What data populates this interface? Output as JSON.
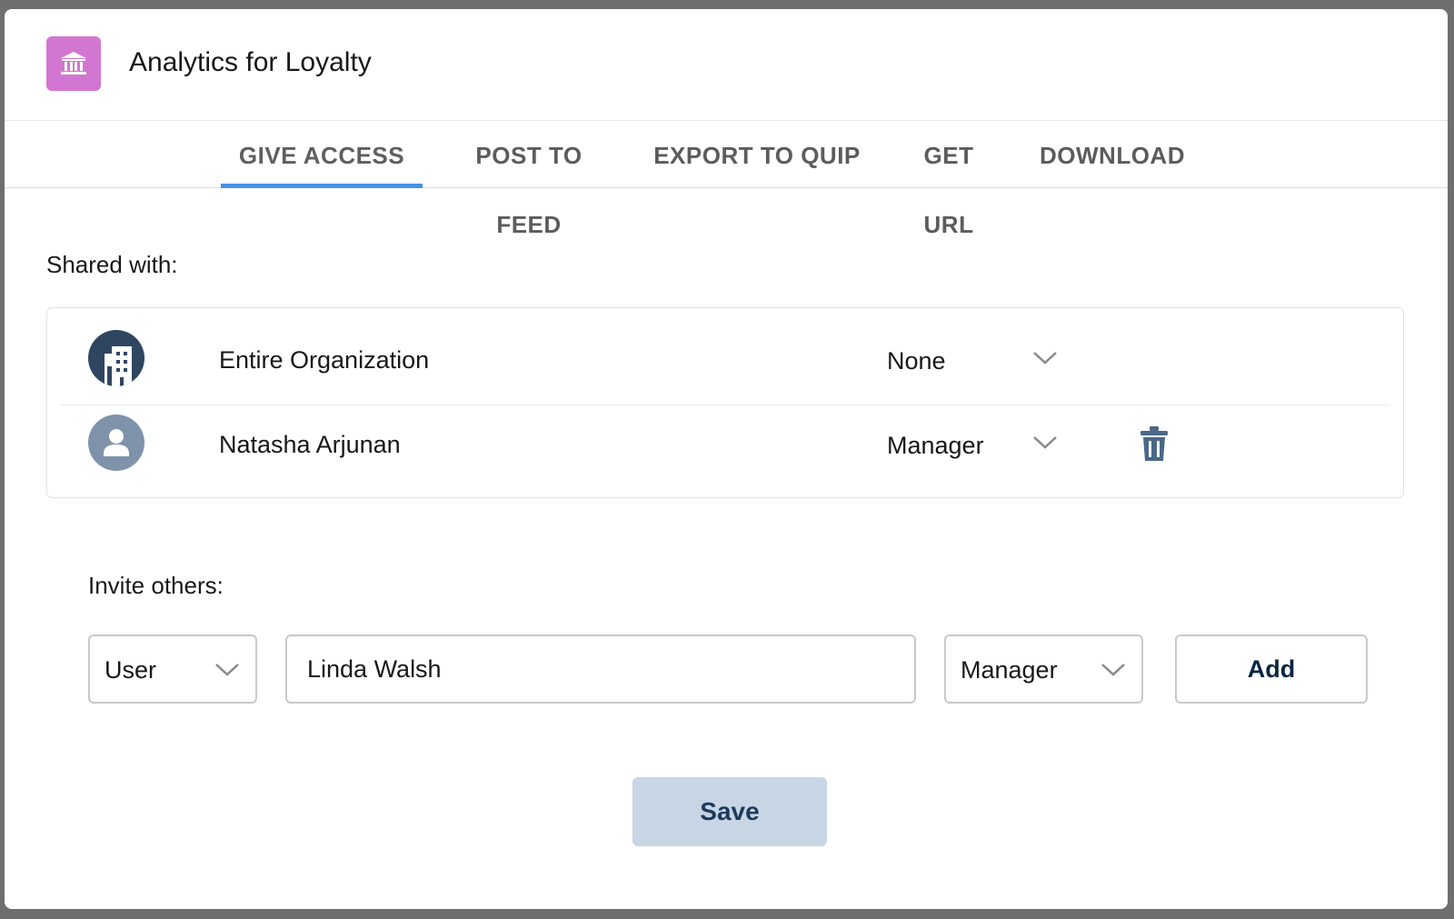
{
  "header": {
    "title": "Analytics for Loyalty",
    "icon": "bank-icon",
    "icon_color": "#d376d1"
  },
  "tabs": [
    {
      "label": "GIVE ACCESS",
      "active": true
    },
    {
      "label": "POST TO FEED",
      "active": false
    },
    {
      "label": "EXPORT TO QUIP",
      "active": false
    },
    {
      "label": "GET URL",
      "active": false
    },
    {
      "label": "DOWNLOAD",
      "active": false
    }
  ],
  "accent_color": "#4a90e8",
  "shared": {
    "label": "Shared with:",
    "rows": [
      {
        "name": "Entire Organization",
        "role": "None",
        "icon": "building-icon",
        "deletable": false
      },
      {
        "name": "Natasha Arjunan",
        "role": "Manager",
        "icon": "user-icon",
        "deletable": true
      }
    ]
  },
  "invite": {
    "label": "Invite others:",
    "type_value": "User",
    "name_value": "Linda Walsh",
    "role_value": "Manager",
    "add_label": "Add"
  },
  "save_label": "Save"
}
